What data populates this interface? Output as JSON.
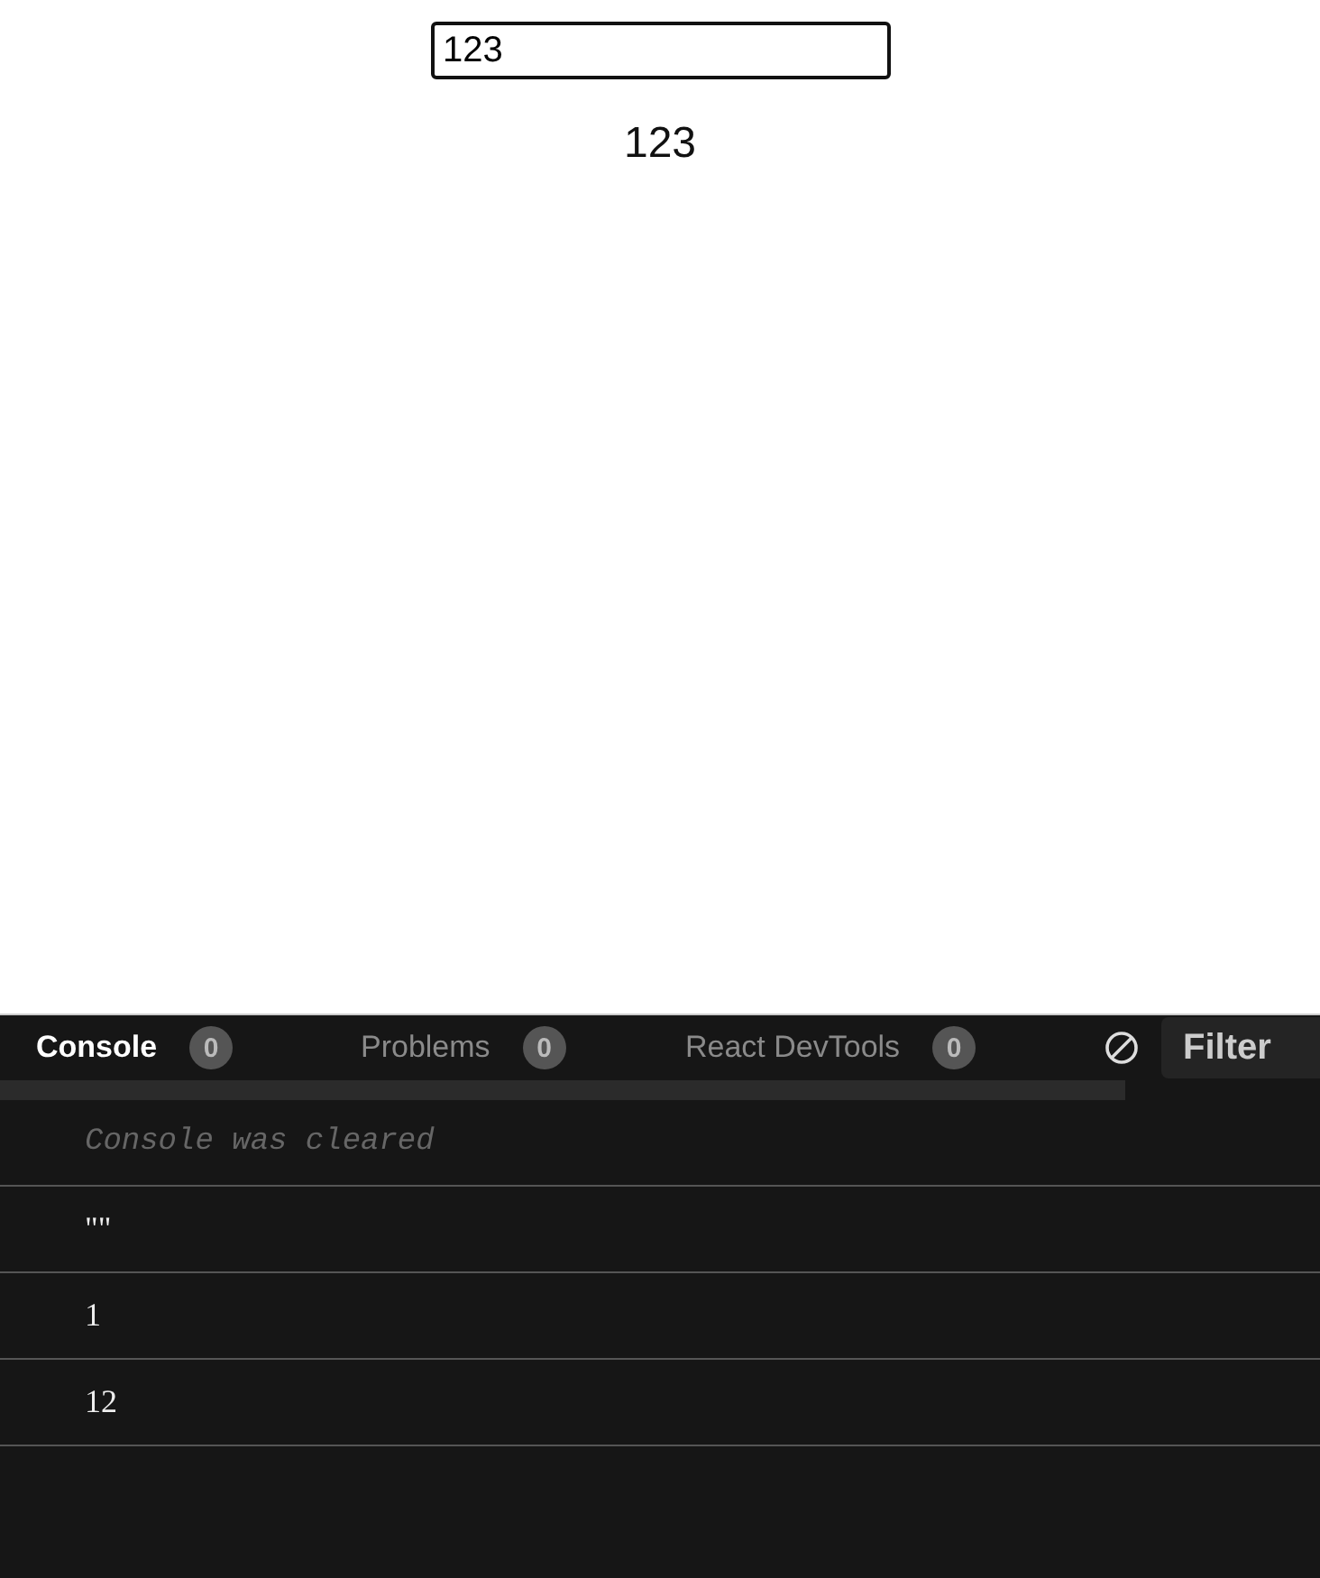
{
  "app": {
    "input": {
      "value": "123"
    },
    "output": "123"
  },
  "panel": {
    "tabs": [
      {
        "label": "Console",
        "count": "0",
        "selected": true
      },
      {
        "label": "Problems",
        "count": "0",
        "selected": false
      },
      {
        "label": "React DevTools",
        "count": "0",
        "selected": false
      }
    ],
    "filter": {
      "placeholder": "Filter"
    },
    "logs": [
      {
        "kind": "info",
        "text": "Console was cleared"
      },
      {
        "kind": "log",
        "text": "\"\""
      },
      {
        "kind": "log",
        "text": "1"
      },
      {
        "kind": "log",
        "text": "12"
      }
    ]
  }
}
